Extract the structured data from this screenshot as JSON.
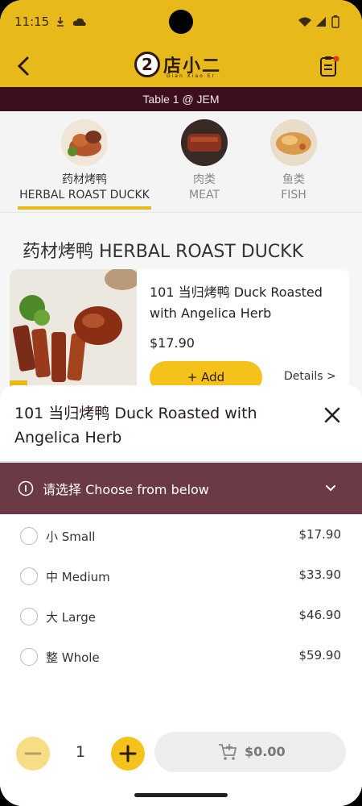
{
  "status": {
    "time": "11:15"
  },
  "header": {
    "logo_cn": "店小二",
    "logo_py": "Dian Xiao Er",
    "logo_num": "2",
    "table_label": "Table 1 @ JEM"
  },
  "categories": [
    {
      "cn": "药材烤鸭",
      "en": "HERBAL ROAST DUCKK",
      "active": true
    },
    {
      "cn": "肉类",
      "en": "MEAT",
      "active": false
    },
    {
      "cn": "鱼类",
      "en": "FISH",
      "active": false
    }
  ],
  "section": {
    "title": "药材烤鸭 HERBAL ROAST DUCKK"
  },
  "item": {
    "name": "101 当归烤鸭 Duck Roasted with Angelica Herb",
    "price": "$17.90",
    "add_label": "+ Add",
    "details_label": "Details >"
  },
  "sheet": {
    "title": "101 当归烤鸭 Duck Roasted with Angelica Herb",
    "choose_label": "请选择 Choose from below",
    "options": [
      {
        "name": "小 Small",
        "price": "$17.90"
      },
      {
        "name": "中 Medium",
        "price": "$33.90"
      },
      {
        "name": "大 Large",
        "price": "$46.90"
      },
      {
        "name": "整 Whole",
        "price": "$59.90"
      }
    ],
    "quantity": "1",
    "cart_total": "$0.00"
  },
  "colors": {
    "brand": "#e8b91a",
    "accent": "#3d0f1c",
    "choose_bar": "#6b3a45"
  }
}
